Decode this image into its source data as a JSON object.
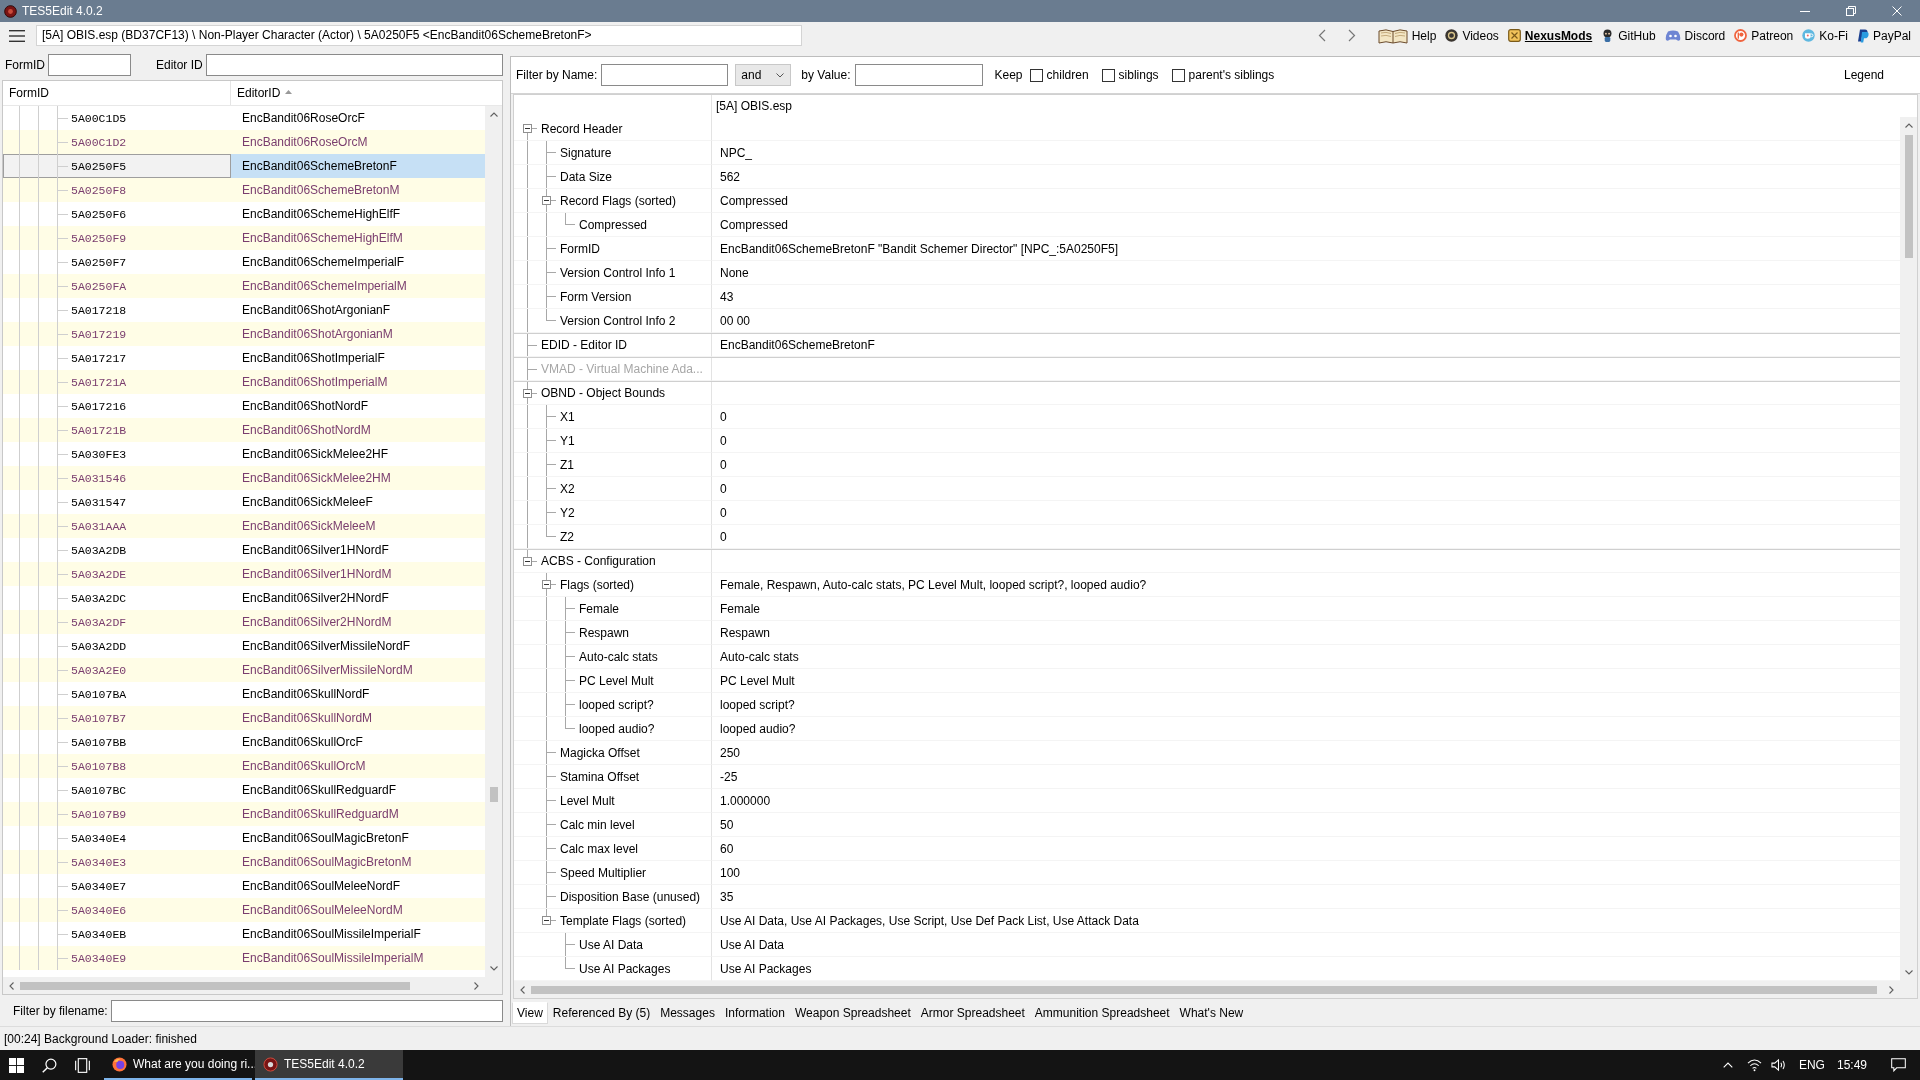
{
  "window": {
    "title": "TES5Edit 4.0.2"
  },
  "toolbar": {
    "path": "[5A] OBIS.esp (BD37CF13) \\ Non-Player Character (Actor) \\ 5A0250F5 <EncBandit06SchemeBretonF>",
    "links": [
      {
        "label": "Help",
        "kind": "book",
        "highlighted": false
      },
      {
        "label": "Videos",
        "kind": "disc",
        "highlighted": false
      },
      {
        "label": "NexusMods",
        "kind": "tile",
        "highlighted": true
      },
      {
        "label": "GitHub",
        "kind": "figure",
        "highlighted": false
      },
      {
        "label": "Discord",
        "kind": "controller",
        "highlighted": false
      },
      {
        "label": "Patreon",
        "kind": "ring",
        "highlighted": false
      },
      {
        "label": "Ko-Fi",
        "kind": "cup",
        "highlighted": false
      },
      {
        "label": "PayPal",
        "kind": "marks",
        "highlighted": false
      }
    ]
  },
  "record_filter": {
    "form_id_label": "FormID",
    "editor_id_label": "Editor ID"
  },
  "record_list": {
    "columns": [
      {
        "label": "FormID",
        "sorted": false
      },
      {
        "label": "EditorID",
        "sorted": true
      }
    ],
    "rows": [
      {
        "form_id": "5A00C1D5",
        "editor_id": "EncBandit06RoseOrcF",
        "highlighted": false,
        "selected": false
      },
      {
        "form_id": "5A00C1D2",
        "editor_id": "EncBandit06RoseOrcM",
        "highlighted": true,
        "selected": false
      },
      {
        "form_id": "5A0250F5",
        "editor_id": "EncBandit06SchemeBretonF",
        "highlighted": false,
        "selected": true
      },
      {
        "form_id": "5A0250F8",
        "editor_id": "EncBandit06SchemeBretonM",
        "highlighted": true,
        "selected": false
      },
      {
        "form_id": "5A0250F6",
        "editor_id": "EncBandit06SchemeHighElfF",
        "highlighted": false,
        "selected": false
      },
      {
        "form_id": "5A0250F9",
        "editor_id": "EncBandit06SchemeHighElfM",
        "highlighted": true,
        "selected": false
      },
      {
        "form_id": "5A0250F7",
        "editor_id": "EncBandit06SchemeImperialF",
        "highlighted": false,
        "selected": false
      },
      {
        "form_id": "5A0250FA",
        "editor_id": "EncBandit06SchemeImperialM",
        "highlighted": true,
        "selected": false
      },
      {
        "form_id": "5A017218",
        "editor_id": "EncBandit06ShotArgonianF",
        "highlighted": false,
        "selected": false
      },
      {
        "form_id": "5A017219",
        "editor_id": "EncBandit06ShotArgonianM",
        "highlighted": true,
        "selected": false
      },
      {
        "form_id": "5A017217",
        "editor_id": "EncBandit06ShotImperialF",
        "highlighted": false,
        "selected": false
      },
      {
        "form_id": "5A01721A",
        "editor_id": "EncBandit06ShotImperialM",
        "highlighted": true,
        "selected": false
      },
      {
        "form_id": "5A017216",
        "editor_id": "EncBandit06ShotNordF",
        "highlighted": false,
        "selected": false
      },
      {
        "form_id": "5A01721B",
        "editor_id": "EncBandit06ShotNordM",
        "highlighted": true,
        "selected": false
      },
      {
        "form_id": "5A030FE3",
        "editor_id": "EncBandit06SickMelee2HF",
        "highlighted": false,
        "selected": false
      },
      {
        "form_id": "5A031546",
        "editor_id": "EncBandit06SickMelee2HM",
        "highlighted": true,
        "selected": false
      },
      {
        "form_id": "5A031547",
        "editor_id": "EncBandit06SickMeleeF",
        "highlighted": false,
        "selected": false
      },
      {
        "form_id": "5A031AAA",
        "editor_id": "EncBandit06SickMeleeM",
        "highlighted": true,
        "selected": false
      },
      {
        "form_id": "5A03A2DB",
        "editor_id": "EncBandit06Silver1HNordF",
        "highlighted": false,
        "selected": false
      },
      {
        "form_id": "5A03A2DE",
        "editor_id": "EncBandit06Silver1HNordM",
        "highlighted": true,
        "selected": false
      },
      {
        "form_id": "5A03A2DC",
        "editor_id": "EncBandit06Silver2HNordF",
        "highlighted": false,
        "selected": false
      },
      {
        "form_id": "5A03A2DF",
        "editor_id": "EncBandit06Silver2HNordM",
        "highlighted": true,
        "selected": false
      },
      {
        "form_id": "5A03A2DD",
        "editor_id": "EncBandit06SilverMissileNordF",
        "highlighted": false,
        "selected": false
      },
      {
        "form_id": "5A03A2E0",
        "editor_id": "EncBandit06SilverMissileNordM",
        "highlighted": true,
        "selected": false
      },
      {
        "form_id": "5A0107BA",
        "editor_id": "EncBandit06SkullNordF",
        "highlighted": false,
        "selected": false
      },
      {
        "form_id": "5A0107B7",
        "editor_id": "EncBandit06SkullNordM",
        "highlighted": true,
        "selected": false
      },
      {
        "form_id": "5A0107BB",
        "editor_id": "EncBandit06SkullOrcF",
        "highlighted": false,
        "selected": false
      },
      {
        "form_id": "5A0107B8",
        "editor_id": "EncBandit06SkullOrcM",
        "highlighted": true,
        "selected": false
      },
      {
        "form_id": "5A0107BC",
        "editor_id": "EncBandit06SkullRedguardF",
        "highlighted": false,
        "selected": false
      },
      {
        "form_id": "5A0107B9",
        "editor_id": "EncBandit06SkullRedguardM",
        "highlighted": true,
        "selected": false
      },
      {
        "form_id": "5A0340E4",
        "editor_id": "EncBandit06SoulMagicBretonF",
        "highlighted": false,
        "selected": false
      },
      {
        "form_id": "5A0340E3",
        "editor_id": "EncBandit06SoulMagicBretonM",
        "highlighted": true,
        "selected": false
      },
      {
        "form_id": "5A0340E7",
        "editor_id": "EncBandit06SoulMeleeNordF",
        "highlighted": false,
        "selected": false
      },
      {
        "form_id": "5A0340E6",
        "editor_id": "EncBandit06SoulMeleeNordM",
        "highlighted": true,
        "selected": false
      },
      {
        "form_id": "5A0340EB",
        "editor_id": "EncBandit06SoulMissileImperialF",
        "highlighted": false,
        "selected": false
      },
      {
        "form_id": "5A0340E9",
        "editor_id": "EncBandit06SoulMissileImperialM",
        "highlighted": true,
        "selected": false
      }
    ]
  },
  "file_filter": {
    "label": "Filter by filename:"
  },
  "view_filter": {
    "name_label": "Filter by Name:",
    "operator": "and",
    "value_label": "by Value:",
    "keep_label": "Keep",
    "keep_options": [
      {
        "label": "children",
        "checked": false
      },
      {
        "label": "siblings",
        "checked": false
      },
      {
        "label": "parent's siblings",
        "checked": false
      }
    ],
    "legend": "Legend"
  },
  "record_view": {
    "file_header": "[5A] OBIS.esp",
    "nodes": [
      {
        "label": "Record Header",
        "expanded": true,
        "disabled": false,
        "children": [
          {
            "label": "Signature",
            "value": "NPC_",
            "disabled": false
          },
          {
            "label": "Data Size",
            "value": "562",
            "disabled": false
          },
          {
            "label": "Record Flags (sorted)",
            "value": "Compressed",
            "expanded": true,
            "disabled": false,
            "children": [
              {
                "label": "Compressed",
                "value": "Compressed",
                "disabled": false
              }
            ]
          },
          {
            "label": "FormID",
            "value": "EncBandit06SchemeBretonF \"Bandit Schemer Director\" [NPC_:5A0250F5]",
            "disabled": false
          },
          {
            "label": "Version Control Info 1",
            "value": "None",
            "disabled": false
          },
          {
            "label": "Form Version",
            "value": "43",
            "disabled": false
          },
          {
            "label": "Version Control Info 2",
            "value": "00 00",
            "disabled": false
          }
        ]
      },
      {
        "label": "EDID - Editor ID",
        "value": "EncBandit06SchemeBretonF",
        "disabled": false
      },
      {
        "label": "VMAD - Virtual Machine Ada...",
        "disabled": true
      },
      {
        "label": "OBND - Object Bounds",
        "expanded": true,
        "disabled": false,
        "children": [
          {
            "label": "X1",
            "value": "0",
            "disabled": false
          },
          {
            "label": "Y1",
            "value": "0",
            "disabled": false
          },
          {
            "label": "Z1",
            "value": "0",
            "disabled": false
          },
          {
            "label": "X2",
            "value": "0",
            "disabled": false
          },
          {
            "label": "Y2",
            "value": "0",
            "disabled": false
          },
          {
            "label": "Z2",
            "value": "0",
            "disabled": false
          }
        ]
      },
      {
        "label": "ACBS - Configuration",
        "expanded": true,
        "disabled": false,
        "children": [
          {
            "label": "Flags (sorted)",
            "value": "Female, Respawn, Auto-calc stats, PC Level Mult, looped script?, looped audio?",
            "expanded": true,
            "disabled": false,
            "children": [
              {
                "label": "Female",
                "value": "Female",
                "disabled": false
              },
              {
                "label": "Respawn",
                "value": "Respawn",
                "disabled": false
              },
              {
                "label": "Auto-calc stats",
                "value": "Auto-calc stats",
                "disabled": false
              },
              {
                "label": "PC Level Mult",
                "value": "PC Level Mult",
                "disabled": false
              },
              {
                "label": "looped script?",
                "value": "looped script?",
                "disabled": false
              },
              {
                "label": "looped audio?",
                "value": "looped audio?",
                "disabled": false
              }
            ]
          },
          {
            "label": "Magicka Offset",
            "value": "250",
            "disabled": false
          },
          {
            "label": "Stamina Offset",
            "value": "-25",
            "disabled": false
          },
          {
            "label": "Level Mult",
            "value": "1.000000",
            "disabled": false
          },
          {
            "label": "Calc min level",
            "value": "50",
            "disabled": false
          },
          {
            "label": "Calc max level",
            "value": "60",
            "disabled": false
          },
          {
            "label": "Speed Multiplier",
            "value": "100",
            "disabled": false
          },
          {
            "label": "Disposition Base (unused)",
            "value": "35",
            "disabled": false
          },
          {
            "label": "Template Flags (sorted)",
            "value": "Use AI Data, Use AI Packages, Use Script, Use Def Pack List, Use Attack Data",
            "expanded": true,
            "disabled": false,
            "children": [
              {
                "label": "Use AI Data",
                "value": "Use AI Data",
                "disabled": false
              },
              {
                "label": "Use AI Packages",
                "value": "Use AI Packages",
                "disabled": false
              }
            ]
          }
        ]
      }
    ]
  },
  "bottom_tabs": [
    {
      "label": "View",
      "selected": true
    },
    {
      "label": "Referenced By (5)",
      "selected": false
    },
    {
      "label": "Messages",
      "selected": false
    },
    {
      "label": "Information",
      "selected": false
    },
    {
      "label": "Weapon Spreadsheet",
      "selected": false
    },
    {
      "label": "Armor Spreadsheet",
      "selected": false
    },
    {
      "label": "Ammunition Spreadsheet",
      "selected": false
    },
    {
      "label": "What's New",
      "selected": false
    }
  ],
  "status_bar": {
    "text": "[00:24] Background Loader: finished"
  },
  "taskbar": {
    "items": [
      {
        "label": "What are you doing ri...",
        "kind": "browser",
        "selected": false
      },
      {
        "label": "TES5Edit 4.0.2",
        "kind": "app",
        "selected": true
      }
    ],
    "language": "ENG",
    "time": "15:49"
  }
}
